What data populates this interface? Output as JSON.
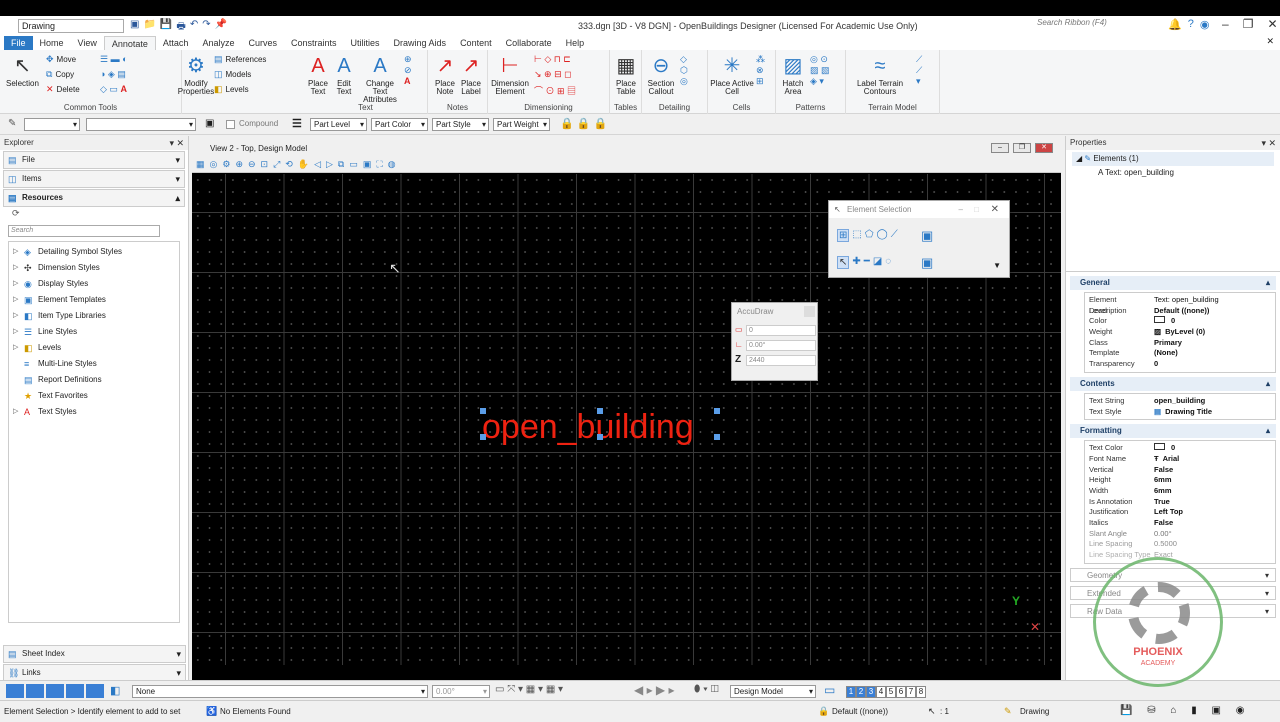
{
  "window": {
    "workspace": "Drawing",
    "title": "333.dgn [3D - V8 DGN] - OpenBuildings Designer (Licensed For Academic Use Only)",
    "search_placeholder": "Search Ribbon (F4)"
  },
  "tabs": [
    "File",
    "Home",
    "View",
    "Annotate",
    "Attach",
    "Analyze",
    "Curves",
    "Constraints",
    "Utilities",
    "Drawing Aids",
    "Content",
    "Collaborate",
    "Help"
  ],
  "active_tab": "Annotate",
  "ribbon": {
    "common_tools": {
      "label": "Common Tools",
      "selection": "Selection",
      "move": "Move",
      "copy": "Copy",
      "delete": "Delete",
      "modify_properties": "Modify Properties",
      "references": "References",
      "models": "Models",
      "levels": "Levels"
    },
    "text": {
      "label": "Text",
      "place_text": "Place Text",
      "edit_text": "Edit Text",
      "change_text_attributes": "Change Text Attributes"
    },
    "notes": {
      "label": "Notes",
      "place_note": "Place Note",
      "place_label": "Place Label"
    },
    "dimensioning": {
      "label": "Dimensioning",
      "dimension_element": "Dimension Element"
    },
    "tables": {
      "label": "Tables",
      "place_table": "Place Table"
    },
    "detailing": {
      "label": "Detailing",
      "section_callout": "Section Callout"
    },
    "cells": {
      "label": "Cells",
      "place_active_cell": "Place Active Cell"
    },
    "patterns": {
      "label": "Patterns",
      "hatch_area": "Hatch Area"
    },
    "terrain": {
      "label": "Terrain Model",
      "label_terrain_contours": "Label Terrain Contours"
    }
  },
  "toolbar": {
    "compound": "Compound",
    "part_level": "Part Level",
    "part_color": "Part Color",
    "part_style": "Part Style",
    "part_weight": "Part Weight"
  },
  "explorer": {
    "title": "Explorer",
    "file": "File",
    "items": "Items",
    "resources": "Resources",
    "search_placeholder": "Search",
    "tree": [
      "Detailing Symbol Styles",
      "Dimension Styles",
      "Display Styles",
      "Element Templates",
      "Item Type Libraries",
      "Line Styles",
      "Levels",
      "Multi-Line Styles",
      "Report Definitions",
      "Text Favorites",
      "Text Styles"
    ],
    "sheet_index": "Sheet Index",
    "links": "Links"
  },
  "view": {
    "title": "View 2 - Top, Design Model",
    "drawn_text": "open_building"
  },
  "element_selection": {
    "title": "Element Selection"
  },
  "accudraw": {
    "title": "AccuDraw",
    "x": "0",
    "angle": "0.00°",
    "z": "2440",
    "z_label": "Z"
  },
  "properties": {
    "title": "Properties",
    "tree_root": "Elements (1)",
    "tree_child": "Text: open_building",
    "general": {
      "label": "General",
      "rows": [
        [
          "Element Description",
          "Text: open_building"
        ],
        [
          "Level",
          "Default ((none))"
        ],
        [
          "Color",
          "0"
        ],
        [
          "Weight",
          "ByLevel (0)"
        ],
        [
          "Class",
          "Primary"
        ],
        [
          "Template",
          "(None)"
        ],
        [
          "Transparency",
          "0"
        ]
      ]
    },
    "contents": {
      "label": "Contents",
      "rows": [
        [
          "Text String",
          "open_building"
        ],
        [
          "Text Style",
          "Drawing Title"
        ]
      ]
    },
    "formatting": {
      "label": "Formatting",
      "rows": [
        [
          "Text Color",
          "0"
        ],
        [
          "Font Name",
          "Arial"
        ],
        [
          "Vertical",
          "False"
        ],
        [
          "Height",
          "6mm"
        ],
        [
          "Width",
          "6mm"
        ],
        [
          "Is Annotation",
          "True"
        ],
        [
          "Justification",
          "Left Top"
        ],
        [
          "Italics",
          "False"
        ],
        [
          "Slant Angle",
          "0.00°"
        ],
        [
          "Line Spacing",
          "0.5000"
        ],
        [
          "Line Spacing Type",
          "Exact"
        ]
      ]
    },
    "geometry": "Geometry",
    "extended": "Extended",
    "raw_data": "Raw Data"
  },
  "bottombar": {
    "level": "None",
    "angle": "0.00°",
    "model": "Design Model",
    "views": [
      "1",
      "2",
      "3",
      "4",
      "5",
      "6",
      "7",
      "8"
    ]
  },
  "status": {
    "prompt": "Element Selection > Identify element to add to set",
    "found": "No Elements Found",
    "level": "Default ((none))",
    "count": ": 1",
    "workflow": "Drawing"
  },
  "watermark": {
    "name": "PHOENIX",
    "sub": "ACADEMY"
  },
  "colors": {
    "accent": "#2b79c5",
    "drawn_text": "#ee2211",
    "canvas": "#000000"
  }
}
